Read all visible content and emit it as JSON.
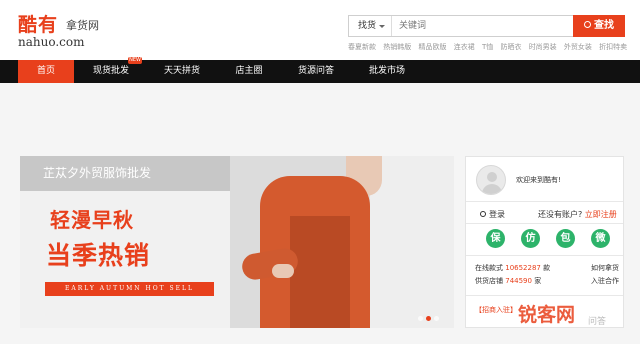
{
  "header": {
    "logo_text": "酷有",
    "logo_sub": "拿货网",
    "logo_domain": "nahuo.com"
  },
  "search": {
    "category": "找货",
    "placeholder": "关键词",
    "button_label": "查找",
    "hotwords": [
      "春夏新款",
      "热销韩版",
      "精品欧版",
      "连衣裙",
      "T恤",
      "防晒衣",
      "时尚男装",
      "外贸女装",
      "折扣特卖"
    ]
  },
  "nav": {
    "items": [
      {
        "label": "首页"
      },
      {
        "label": "现货批发"
      },
      {
        "label": "天天拼货"
      },
      {
        "label": "店主圈"
      },
      {
        "label": "货源问答"
      },
      {
        "label": "批发市场"
      }
    ],
    "badge": "NEW"
  },
  "banner": {
    "tagline": "芷苁夕外贸服饰批发",
    "headline1": "轻漫早秋",
    "headline2": "当季热销",
    "strip": "EARLY AUTUMN HOT SELL"
  },
  "side": {
    "welcome": "欢迎来到酷有!",
    "login": "登录",
    "no_account": "还没有账户?",
    "register": "立即注册",
    "badges": [
      "保",
      "仿",
      "包",
      "微"
    ],
    "stat1_label": "在线款式",
    "stat1_value": "10652287",
    "stat1_unit": "款",
    "stat2_label": "供货店铺",
    "stat2_value": "744590",
    "stat2_unit": "家",
    "link1": "如何拿货",
    "link2": "入驻合作",
    "merchant": "【招商入驻】"
  },
  "watermark": {
    "text": "锐客网",
    "sub": "问答"
  },
  "colors": {
    "accent": "#e8401c",
    "nav_bg": "#111111",
    "badge_green": "#2db36a"
  }
}
